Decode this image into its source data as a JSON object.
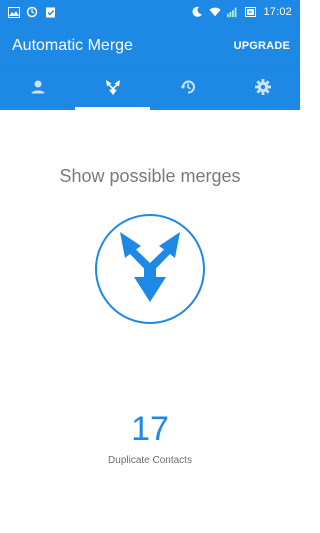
{
  "status_bar": {
    "time": "17:02",
    "icons": [
      "image-icon",
      "sync-icon",
      "clipboard-check-icon",
      "moon-icon",
      "wifi-icon",
      "signal-icon",
      "battery-icon"
    ]
  },
  "app_bar": {
    "title": "Automatic Merge",
    "action_label": "UPGRADE"
  },
  "tabs": [
    {
      "icon": "person-icon",
      "active": false
    },
    {
      "icon": "merge-icon",
      "active": true
    },
    {
      "icon": "history-icon",
      "active": false
    },
    {
      "icon": "gear-icon",
      "active": false
    }
  ],
  "main": {
    "headline": "Show possible merges",
    "count": "17",
    "count_label": "Duplicate Contacts"
  },
  "colors": {
    "primary": "#1e88e5",
    "text_gray": "#7a7a7a"
  }
}
